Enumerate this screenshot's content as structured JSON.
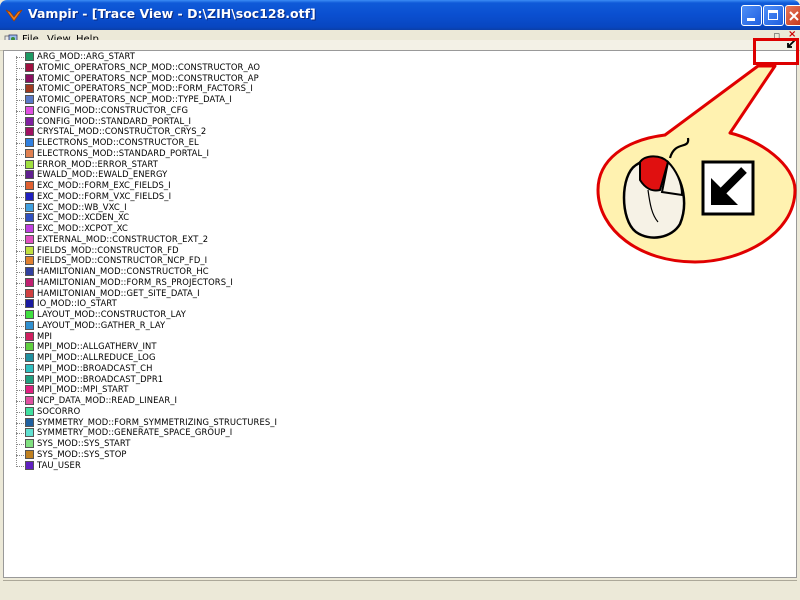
{
  "window": {
    "title": "Vampir - [Trace View - D:\\ZIH\\soc128.otf]"
  },
  "menu": {
    "items": [
      "File",
      "View",
      "Help"
    ]
  },
  "inner_window_buttons": {
    "minimize": "_",
    "restore": "▫",
    "close": "×"
  },
  "legend": [
    {
      "label": "ARG_MOD::ARG_START",
      "color": "#1e9a64"
    },
    {
      "label": "ATOMIC_OPERATORS_NCP_MOD::CONSTRUCTOR_AO",
      "color": "#a01040"
    },
    {
      "label": "ATOMIC_OPERATORS_NCP_MOD::CONSTRUCTOR_AP",
      "color": "#8a1060"
    },
    {
      "label": "ATOMIC_OPERATORS_NCP_MOD::FORM_FACTORS_I",
      "color": "#a03a20"
    },
    {
      "label": "ATOMIC_OPERATORS_NCP_MOD::TYPE_DATA_I",
      "color": "#5a7ac8"
    },
    {
      "label": "CONFIG_MOD::CONSTRUCTOR_CFG",
      "color": "#e050e0"
    },
    {
      "label": "CONFIG_MOD::STANDARD_PORTAL_I",
      "color": "#8020a0"
    },
    {
      "label": "CRYSTAL_MOD::CONSTRUCTOR_CRYS_2",
      "color": "#a01060"
    },
    {
      "label": "ELECTRONS_MOD::CONSTRUCTOR_EL",
      "color": "#3080e0"
    },
    {
      "label": "ELECTRONS_MOD::STANDARD_PORTAL_I",
      "color": "#e08050"
    },
    {
      "label": "ERROR_MOD::ERROR_START",
      "color": "#a0e040"
    },
    {
      "label": "EWALD_MOD::EWALD_ENERGY",
      "color": "#602090"
    },
    {
      "label": "EXC_MOD::FORM_EXC_FIELDS_I",
      "color": "#e06030"
    },
    {
      "label": "EXC_MOD::FORM_VXC_FIELDS_I",
      "color": "#2020c0"
    },
    {
      "label": "EXC_MOD::WB_VXC_I",
      "color": "#40a0e0"
    },
    {
      "label": "EXC_MOD::XCDEN_XC",
      "color": "#3050c0"
    },
    {
      "label": "EXC_MOD::XCPOT_XC",
      "color": "#c040e0"
    },
    {
      "label": "EXTERNAL_MOD::CONSTRUCTOR_EXT_2",
      "color": "#e050c0"
    },
    {
      "label": "FIELDS_MOD::CONSTRUCTOR_FD",
      "color": "#c0e040"
    },
    {
      "label": "FIELDS_MOD::CONSTRUCTOR_NCP_FD_I",
      "color": "#e08030"
    },
    {
      "label": "HAMILTONIAN_MOD::CONSTRUCTOR_HC",
      "color": "#3040a0"
    },
    {
      "label": "HAMILTONIAN_MOD::FORM_RS_PROJECTORS_I",
      "color": "#c02070"
    },
    {
      "label": "HAMILTONIAN_MOD::GET_SITE_DATA_I",
      "color": "#d04040"
    },
    {
      "label": "IO_MOD::IO_START",
      "color": "#1a1aa0"
    },
    {
      "label": "LAYOUT_MOD::CONSTRUCTOR_LAY",
      "color": "#40e040"
    },
    {
      "label": "LAYOUT_MOD::GATHER_R_LAY",
      "color": "#3090d0"
    },
    {
      "label": "MPI",
      "color": "#d02060"
    },
    {
      "label": "MPI_MOD::ALLGATHERV_INT",
      "color": "#60d040"
    },
    {
      "label": "MPI_MOD::ALLREDUCE_LOG",
      "color": "#2090a0"
    },
    {
      "label": "MPI_MOD::BROADCAST_CH",
      "color": "#30c0c0"
    },
    {
      "label": "MPI_MOD::BROADCAST_DPR1",
      "color": "#20a080"
    },
    {
      "label": "MPI_MOD::MPI_START",
      "color": "#e02080"
    },
    {
      "label": "NCP_DATA_MOD::READ_LINEAR_I",
      "color": "#e050a0"
    },
    {
      "label": "SOCORRO",
      "color": "#40e0a0"
    },
    {
      "label": "SYMMETRY_MOD::FORM_SYMMETRIZING_STRUCTURES_I",
      "color": "#2060a0"
    },
    {
      "label": "SYMMETRY_MOD::GENERATE_SPACE_GROUP_I",
      "color": "#60e0d0"
    },
    {
      "label": "SYS_MOD::SYS_START",
      "color": "#80e080"
    },
    {
      "label": "SYS_MOD::SYS_STOP",
      "color": "#c08020"
    },
    {
      "label": "TAU_USER",
      "color": "#6020c0"
    }
  ],
  "colors": {
    "titlebar": "#0a4fd0",
    "callout_fill": "#fff2b0",
    "callout_stroke": "#e00000",
    "highlight_box": "#dd0000"
  },
  "icons": [
    "vampir-app-icon",
    "menu-doc-icon",
    "mouse-icon",
    "resize-arrow-icon"
  ]
}
